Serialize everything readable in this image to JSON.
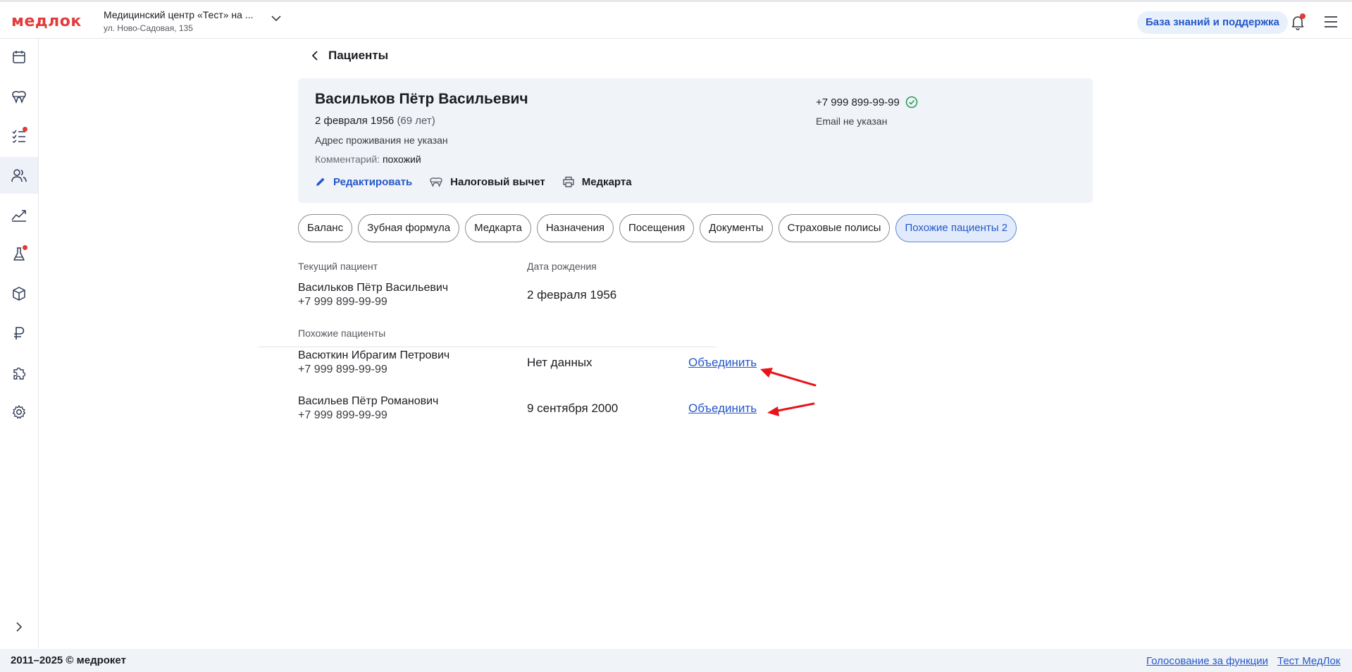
{
  "header": {
    "logo": "медлок",
    "clinic_name": "Медицинский центр «Тест» на ...",
    "clinic_address": "ул. Ново-Садовая, 135",
    "help_label": "База знаний и поддержка"
  },
  "sidebar": {
    "items": [
      {
        "icon": "calendar-icon"
      },
      {
        "icon": "teeth-icon"
      },
      {
        "icon": "tasks-icon",
        "badge": true
      },
      {
        "icon": "patients-icon",
        "active": true
      },
      {
        "icon": "analytics-icon"
      },
      {
        "icon": "lab-flask-icon",
        "badge": true
      },
      {
        "icon": "box-icon"
      },
      {
        "icon": "ruble-icon"
      },
      {
        "icon": "puzzle-icon"
      },
      {
        "icon": "gear-icon"
      }
    ]
  },
  "breadcrumb": {
    "back_label": "Пациенты"
  },
  "patient": {
    "name": "Васильков Пётр Васильевич",
    "dob": "2 февраля 1956",
    "age": "(69 лет)",
    "address": "Адрес проживания не указан",
    "comment_label": "Комментарий:",
    "comment_value": "похожий",
    "phone": "+7 999 899-99-99",
    "email": "Email не указан",
    "actions": {
      "edit": "Редактировать",
      "tax": "Налоговый вычет",
      "medcard": "Медкарта"
    }
  },
  "tabs": [
    {
      "label": "Баланс"
    },
    {
      "label": "Зубная формула"
    },
    {
      "label": "Медкарта"
    },
    {
      "label": "Назначения"
    },
    {
      "label": "Посещения"
    },
    {
      "label": "Документы"
    },
    {
      "label": "Страховые полисы"
    },
    {
      "label": "Похожие пациенты 2",
      "active": true
    }
  ],
  "similar": {
    "current_header": "Текущий пациент",
    "dob_header": "Дата рождения",
    "current": {
      "name": "Васильков Пётр Васильевич",
      "phone": "+7 999 899-99-99",
      "dob": "2 февраля 1956"
    },
    "similar_header": "Похожие пациенты",
    "rows": [
      {
        "name": "Васюткин Ибрагим Петрович",
        "phone": "+7 999 899-99-99",
        "dob": "Нет данных",
        "action": "Объединить"
      },
      {
        "name": "Васильев Пётр Романович",
        "phone": "+7 999 899-99-99",
        "dob": "9 сентября 2000",
        "action": "Объединить"
      }
    ]
  },
  "footer": {
    "copyright": "2011–2025 © медрокет",
    "vote_link": "Голосование за функции",
    "test_link": "Тест МедЛок"
  },
  "colors": {
    "accent": "#2458c9",
    "brand_red": "#e23b3b",
    "annotation_arrow": "#e8141c"
  }
}
